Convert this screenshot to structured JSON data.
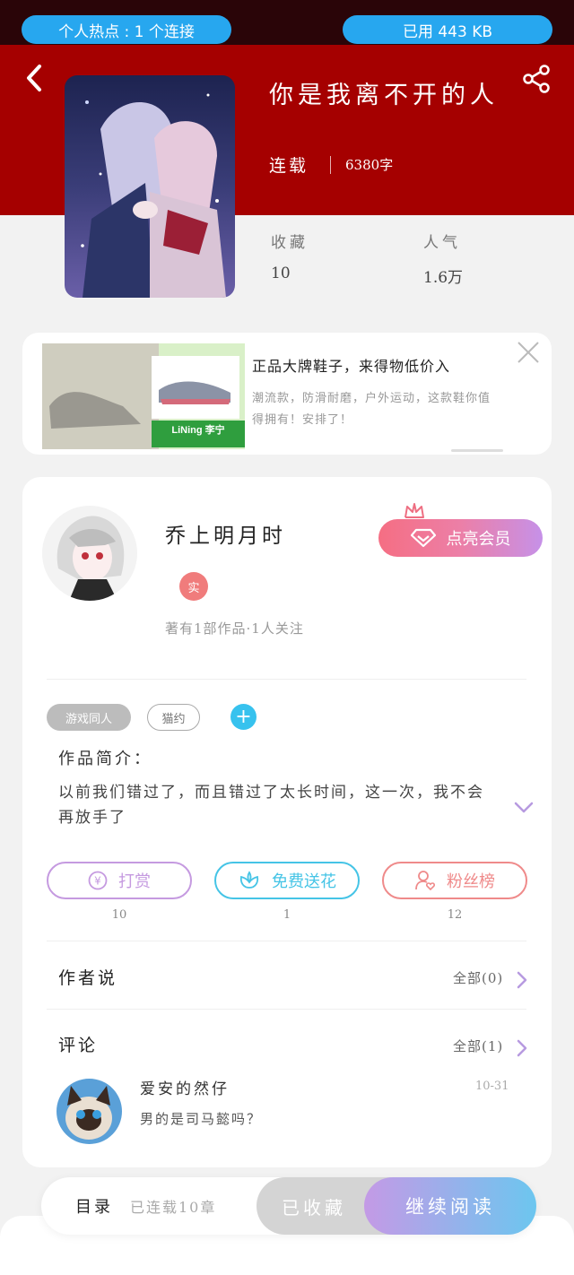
{
  "statusbar": {
    "hotspot": "个人热点 : 1 个连接",
    "data_used": "已用 443 KB"
  },
  "book": {
    "title": "你是我离不开的人",
    "status": "连载",
    "word_count": "6380字",
    "favorites_label": "收藏",
    "favorites_value": "10",
    "popularity_label": "人气",
    "popularity_value": "1.6万"
  },
  "ad": {
    "title": "正品大牌鞋子，来得物低价入",
    "desc": "潮流款，防滑耐磨，户外运动，这款鞋你值得拥有！安排了！",
    "brand_text": "LiNing 李宁"
  },
  "author": {
    "name": "乔上明月时",
    "badge": "实",
    "info": "著有1部作品·1人关注",
    "vip_button": "点亮会员"
  },
  "tags": [
    "游戏同人",
    "猫约"
  ],
  "intro": {
    "heading": "作品简介：",
    "text": "以前我们错过了，而且错过了太长时间，这一次，我不会再放手了"
  },
  "actions": [
    {
      "label": "打赏",
      "count": "10",
      "color": "#c59ae0"
    },
    {
      "label": "免费送花",
      "count": "1",
      "color": "#45c4e6"
    },
    {
      "label": "粉丝榜",
      "count": "12",
      "color": "#ef8a8a"
    }
  ],
  "author_says": {
    "title": "作者说",
    "all": "全部(0)"
  },
  "comments": {
    "title": "评论",
    "all": "全部(1)",
    "items": [
      {
        "user": "爱安的然仔",
        "text": "男的是司马懿吗？",
        "date": "10-31"
      }
    ]
  },
  "bottom": {
    "directory": "目录",
    "episodes": "已连载10章",
    "favorited": "已收藏",
    "continue": "继续阅读"
  },
  "colors": {
    "header": "#a50000",
    "accent_blue": "#27a7ef",
    "vip_gradient_start": "#f56e83",
    "vip_gradient_end": "#c691e8"
  }
}
